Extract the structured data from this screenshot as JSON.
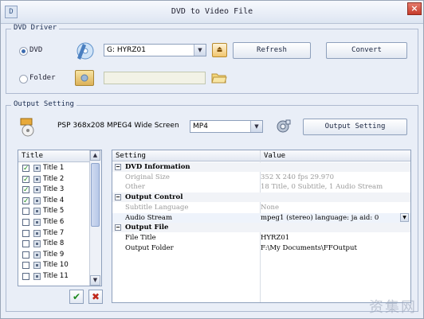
{
  "window": {
    "title": "DVD to Video File",
    "logo_text": "D",
    "close_symbol": "×"
  },
  "dvd_driver": {
    "legend": "DVD Driver",
    "dvd_label": "DVD",
    "folder_label": "Folder",
    "drive_value": "G: HYRZ01",
    "refresh_label": "Refresh",
    "convert_label": "Convert",
    "eject_symbol": "⏏",
    "folder_path_value": ""
  },
  "output_setting": {
    "legend": "Output Setting",
    "profile_text": "PSP 368x208 MPEG4 Wide Screen",
    "format_value": "MP4",
    "output_setting_label": "Output Setting"
  },
  "title_list": {
    "header": "Title",
    "items": [
      {
        "label": "Title 1",
        "checked": true
      },
      {
        "label": "Title 2",
        "checked": true
      },
      {
        "label": "Title 3",
        "checked": true
      },
      {
        "label": "Title 4",
        "checked": true
      },
      {
        "label": "Title 5",
        "checked": false
      },
      {
        "label": "Title 6",
        "checked": false
      },
      {
        "label": "Title 7",
        "checked": false
      },
      {
        "label": "Title 8",
        "checked": false
      },
      {
        "label": "Title 9",
        "checked": false
      },
      {
        "label": "Title 10",
        "checked": false
      },
      {
        "label": "Title 11",
        "checked": false
      }
    ],
    "check_mark": "✓",
    "ok_symbol": "✔",
    "cancel_symbol": "✖"
  },
  "settings_grid": {
    "col_setting": "Setting",
    "col_value": "Value",
    "rows": [
      {
        "type": "section",
        "key": "DVD Information",
        "value": ""
      },
      {
        "type": "grey",
        "key": "Original Size",
        "value": "352 X 240 fps 29.970"
      },
      {
        "type": "grey",
        "key": "Other",
        "value": "18 Title, 0 Subtitle, 1 Audio Stream"
      },
      {
        "type": "section",
        "key": "Output Control",
        "value": ""
      },
      {
        "type": "grey",
        "key": "Subtitle Language",
        "value": "None"
      },
      {
        "type": "selected",
        "key": "Audio Stream",
        "value": "mpeg1 (stereo) language: ja aid: 0"
      },
      {
        "type": "section",
        "key": "Output File",
        "value": ""
      },
      {
        "type": "normal",
        "key": "File Title",
        "value": "HYRZ01"
      },
      {
        "type": "normal",
        "key": "Output Folder",
        "value": "F:\\My Documents\\FFOutput"
      }
    ],
    "expand_symbol": "−"
  },
  "watermark": "资集网"
}
